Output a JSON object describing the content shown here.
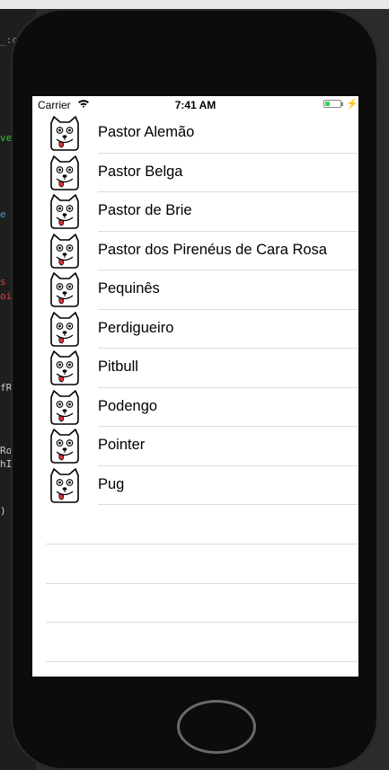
{
  "background": {
    "fragments": [
      {
        "text": "_:c",
        "color": "#888888"
      },
      {
        "text": "ve",
        "color": "#3cbf3c"
      },
      {
        "text": "e",
        "color": "#3ca0d8"
      },
      {
        "text": "s",
        "color": "#e04040"
      },
      {
        "text": "oi",
        "color": "#e04040"
      },
      {
        "text": "fR",
        "color": "#cccccc"
      },
      {
        "text": "Ro",
        "color": "#cccccc"
      },
      {
        "text": "hI",
        "color": "#cccccc"
      },
      {
        "text": ")",
        "color": "#cccccc"
      }
    ]
  },
  "status_bar": {
    "carrier": "Carrier",
    "time": "7:41 AM",
    "battery_level": 0.3,
    "battery_color": "#2bd94b"
  },
  "table": {
    "icon": "dog-face-icon",
    "rows": [
      {
        "label": "Pastor Alemão"
      },
      {
        "label": "Pastor Belga"
      },
      {
        "label": "Pastor de Brie"
      },
      {
        "label": "Pastor dos Pirenéus de Cara Rosa"
      },
      {
        "label": "Pequinês"
      },
      {
        "label": "Perdigueiro"
      },
      {
        "label": "Pitbull"
      },
      {
        "label": "Podengo"
      },
      {
        "label": "Pointer"
      },
      {
        "label": "Pug"
      }
    ]
  }
}
